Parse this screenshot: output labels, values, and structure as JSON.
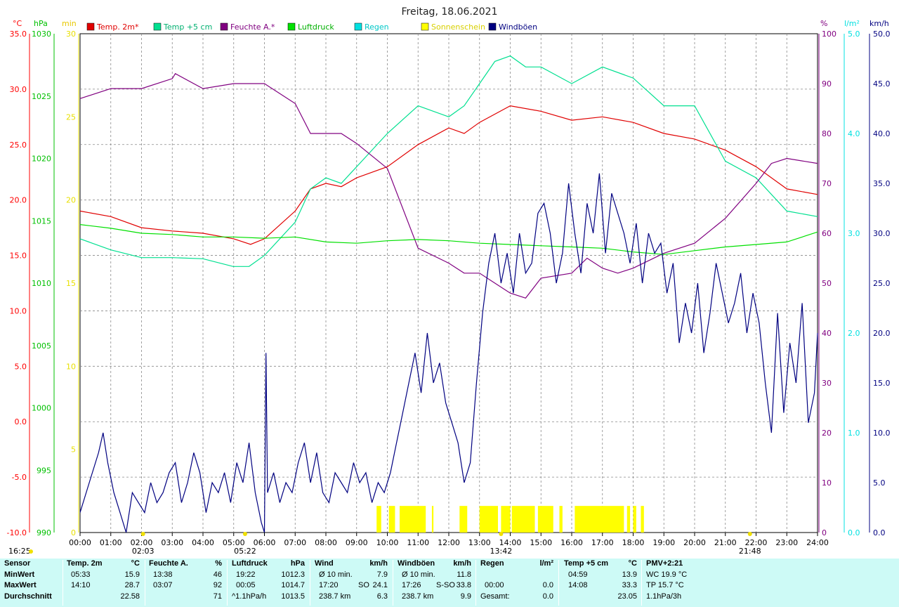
{
  "chart_data": {
    "type": "line",
    "title": "Freitag, 18.06.2021",
    "x_ticks": [
      "00:00",
      "01:00",
      "02:00",
      "03:00",
      "04:00",
      "05:00",
      "06:00",
      "07:00",
      "08:00",
      "09:00",
      "10:00",
      "11:00",
      "12:00",
      "13:00",
      "14:00",
      "15:00",
      "16:00",
      "17:00",
      "18:00",
      "19:00",
      "20:00",
      "21:00",
      "22:00",
      "23:00",
      "24:00"
    ],
    "axes": {
      "temp": {
        "unit": "°C",
        "range": [
          -10,
          35
        ],
        "ticks": [
          "35.0",
          "30.0",
          "25.0",
          "20.0",
          "15.0",
          "10.0",
          "5.0",
          "0.0",
          "-5.0",
          "-10.0"
        ],
        "color": "#ff0000"
      },
      "pressure": {
        "unit": "hPa",
        "range": [
          990,
          1030
        ],
        "ticks": [
          "1030",
          "1025",
          "1020",
          "1015",
          "1010",
          "1005",
          "1000",
          "995",
          "990"
        ],
        "color": "#00c000"
      },
      "sunshine": {
        "unit": "min",
        "range": [
          0,
          30
        ],
        "ticks": [
          "30",
          "25",
          "20",
          "15",
          "10",
          "5",
          "0"
        ],
        "color": "#e0e000"
      },
      "humidity": {
        "unit": "%",
        "range": [
          0,
          100
        ],
        "ticks": [
          "100",
          "90",
          "80",
          "70",
          "60",
          "50",
          "40",
          "30",
          "20",
          "10",
          "0"
        ],
        "color": "#800080"
      },
      "rain": {
        "unit": "l/m²",
        "range": [
          0,
          5
        ],
        "ticks": [
          "5.0",
          "4.0",
          "3.0",
          "2.0",
          "1.0",
          "0.0"
        ],
        "color": "#00e0e0"
      },
      "wind": {
        "unit": "km/h",
        "range": [
          0,
          50
        ],
        "ticks": [
          "50.0",
          "45.0",
          "40.0",
          "35.0",
          "30.0",
          "25.0",
          "20.0",
          "15.0",
          "10.0",
          "5.0",
          "0.0"
        ],
        "color": "#000080"
      }
    },
    "series": [
      {
        "name": "Temp. 2m*",
        "color": "#e00000",
        "axis": "temp",
        "x": [
          0,
          1,
          2,
          3,
          4,
          5,
          5.55,
          6,
          7,
          7.5,
          8,
          8.5,
          9,
          10,
          11,
          12,
          12.5,
          13,
          14,
          15,
          16,
          17,
          18,
          19,
          20,
          21,
          22,
          23,
          24
        ],
        "y": [
          19.0,
          18.5,
          17.5,
          17.2,
          17.0,
          16.5,
          16.0,
          16.5,
          19.0,
          21.0,
          21.5,
          21.2,
          22.0,
          23.0,
          25.0,
          26.5,
          26.0,
          27.0,
          28.5,
          28.0,
          27.2,
          27.5,
          27.0,
          26.0,
          25.5,
          24.5,
          23.0,
          21.0,
          20.5
        ]
      },
      {
        "name": "Temp +5 cm",
        "color": "#00e090",
        "axis": "temp",
        "x": [
          0,
          1,
          2,
          3,
          4,
          4.98,
          5.5,
          6,
          7,
          7.5,
          8,
          8.5,
          9,
          10,
          11,
          11.5,
          12,
          12.5,
          13,
          13.5,
          14,
          14.5,
          15,
          16,
          17,
          18,
          19,
          20,
          21,
          22,
          23,
          24
        ],
        "y": [
          16.5,
          15.5,
          14.8,
          14.8,
          14.7,
          14.0,
          14.0,
          15.0,
          18.0,
          21.0,
          22.0,
          21.5,
          23.0,
          26.0,
          28.5,
          28.0,
          27.5,
          28.5,
          30.5,
          32.5,
          33.0,
          32.0,
          32.0,
          30.5,
          32.0,
          31.0,
          28.5,
          28.5,
          23.5,
          22.0,
          19.0,
          18.5
        ]
      },
      {
        "name": "Feuchte A.*",
        "color": "#800080",
        "axis": "humidity",
        "x": [
          0,
          1,
          2,
          3,
          3.1,
          4,
          5,
          6,
          7,
          7.5,
          8,
          8.5,
          9,
          10,
          11,
          12,
          12.5,
          13,
          13.5,
          14,
          14.5,
          15,
          16,
          16.5,
          17,
          17.5,
          18,
          19,
          20,
          21,
          22,
          22.5,
          23,
          24
        ],
        "y": [
          87,
          89,
          89,
          91,
          92,
          89,
          90,
          90,
          86,
          80,
          80,
          80,
          78,
          73,
          57,
          54,
          52,
          52,
          50,
          48,
          47,
          51,
          52,
          55,
          53,
          52,
          53,
          56,
          58,
          63,
          70,
          74,
          75,
          74
        ]
      },
      {
        "name": "Luftdruck",
        "color": "#00e000",
        "axis": "pressure",
        "x": [
          0,
          1,
          2,
          3,
          4,
          5,
          6,
          7,
          8,
          9,
          10,
          11,
          12,
          13,
          14,
          15,
          16,
          17,
          18,
          19,
          20,
          21,
          22,
          23,
          24
        ],
        "y": [
          1014.7,
          1014.4,
          1014.0,
          1013.9,
          1013.7,
          1013.7,
          1013.6,
          1013.7,
          1013.3,
          1013.2,
          1013.4,
          1013.5,
          1013.4,
          1013.2,
          1013.1,
          1013.0,
          1012.9,
          1012.8,
          1012.5,
          1012.3,
          1012.6,
          1012.9,
          1013.1,
          1013.3,
          1014.1
        ]
      },
      {
        "name": "Regen",
        "color": "#00e0e0",
        "axis": "rain",
        "x": [],
        "y": []
      },
      {
        "name": "Sonnenschein",
        "color": "#ffff00",
        "axis": "sunshine",
        "blocks": [
          [
            9.65,
            9.8
          ],
          [
            10.05,
            10.25
          ],
          [
            10.4,
            11.25
          ],
          [
            11.45,
            11.5
          ],
          [
            12.35,
            12.6
          ],
          [
            13.0,
            13.6
          ],
          [
            13.7,
            14.0
          ],
          [
            14.05,
            14.8
          ],
          [
            14.9,
            15.4
          ],
          [
            15.6,
            15.7
          ],
          [
            16.1,
            17.7
          ],
          [
            17.8,
            17.9
          ],
          [
            18.0,
            18.1
          ],
          [
            18.25,
            18.35
          ]
        ],
        "value": 1
      },
      {
        "name": "Windböen",
        "color": "#000080",
        "axis": "wind",
        "x": [
          0,
          0.3,
          0.6,
          0.75,
          0.9,
          1.1,
          1.3,
          1.5,
          1.7,
          1.9,
          2.1,
          2.3,
          2.5,
          2.7,
          2.9,
          3.1,
          3.3,
          3.5,
          3.7,
          3.9,
          4.1,
          4.3,
          4.5,
          4.7,
          4.9,
          5.1,
          5.3,
          5.5,
          5.7,
          5.9,
          6.0,
          6.05,
          6.1,
          6.3,
          6.5,
          6.7,
          6.9,
          7.1,
          7.3,
          7.5,
          7.7,
          7.9,
          8.1,
          8.3,
          8.5,
          8.7,
          8.9,
          9.1,
          9.3,
          9.5,
          9.7,
          9.9,
          10.1,
          10.3,
          10.5,
          10.7,
          10.9,
          11.1,
          11.3,
          11.5,
          11.7,
          11.9,
          12.1,
          12.3,
          12.5,
          12.7,
          12.9,
          13.1,
          13.3,
          13.5,
          13.7,
          13.9,
          14.1,
          14.3,
          14.5,
          14.7,
          14.9,
          15.1,
          15.3,
          15.5,
          15.7,
          15.9,
          16.1,
          16.3,
          16.5,
          16.7,
          16.9,
          17.1,
          17.3,
          17.5,
          17.7,
          17.9,
          18.1,
          18.3,
          18.5,
          18.7,
          18.9,
          19.1,
          19.3,
          19.5,
          19.7,
          19.9,
          20.1,
          20.3,
          20.5,
          20.7,
          20.9,
          21.1,
          21.3,
          21.5,
          21.7,
          21.9,
          22.1,
          22.3,
          22.5,
          22.7,
          22.9,
          23.1,
          23.3,
          23.5,
          23.7,
          23.9,
          24.0
        ],
        "y": [
          2,
          5,
          8,
          10,
          7,
          4,
          2,
          0,
          4,
          3,
          2,
          5,
          3,
          4,
          6,
          7,
          3,
          5,
          8,
          6,
          2,
          5,
          4,
          6,
          3,
          7,
          5,
          9,
          4,
          1,
          0,
          18,
          4,
          6,
          3,
          5,
          4,
          7,
          9,
          5,
          8,
          4,
          3,
          6,
          5,
          4,
          7,
          5,
          6,
          3,
          5,
          4,
          6,
          9,
          12,
          15,
          18,
          14,
          20,
          15,
          17,
          13,
          11,
          9,
          5,
          7,
          15,
          22,
          27,
          30,
          25,
          28,
          24,
          30,
          26,
          27,
          32,
          33,
          30,
          25,
          28,
          35,
          30,
          26,
          33,
          30,
          36,
          28,
          34,
          32,
          30,
          27,
          31,
          25,
          30,
          28,
          29,
          24,
          27,
          19,
          23,
          20,
          25,
          18,
          22,
          27,
          24,
          21,
          23,
          26,
          20,
          24,
          21,
          15,
          10,
          22,
          12,
          19,
          15,
          23,
          11,
          14,
          20
        ]
      }
    ]
  },
  "legend": [
    {
      "label": "Temp. 2m*",
      "color": "#e00000"
    },
    {
      "label": "Temp +5 cm",
      "color": "#00e090"
    },
    {
      "label": "Feuchte A.*",
      "color": "#800080"
    },
    {
      "label": "Luftdruck",
      "color": "#00e000"
    },
    {
      "label": "Regen",
      "color": "#00e0e0"
    },
    {
      "label": "Sonnenschein",
      "color": "#ffff00"
    },
    {
      "label": "Windböen",
      "color": "#000080"
    }
  ],
  "time_markers": [
    {
      "label": "16:25",
      "time": -0.3
    },
    {
      "label": "02:03",
      "time": 2.05
    },
    {
      "label": "05:22",
      "time": 5.37
    },
    {
      "label": "13:42",
      "time": 13.7
    },
    {
      "label": "21:48",
      "time": 21.8
    }
  ],
  "stats": {
    "sensor": {
      "h1": "Sensor",
      "r1": "MinWert",
      "r2": "MaxWert",
      "r3": "Durchschnitt"
    },
    "temp2m": {
      "h1": "Temp. 2m",
      "u": "°C",
      "min_t": "05:33",
      "min_v": "15.9",
      "max_t": "14:10",
      "max_v": "28.7",
      "avg": "22.58"
    },
    "feuchte": {
      "h1": "Feuchte A.",
      "u": "%",
      "min_t": "13:38",
      "min_v": "46",
      "max_t": "03:07",
      "max_v": "92",
      "avg": "71"
    },
    "luftdruck": {
      "h1": "Luftdruck",
      "u": "hPa",
      "min_t": "19:22",
      "min_v": "1012.3",
      "max_t": "00:05",
      "max_v": "1014.7",
      "avg_l": "^1.1hPa/h",
      "avg": "1013.5"
    },
    "wind": {
      "h1": "Wind",
      "u": "km/h",
      "min_t": "Ø 10 min.",
      "min_v": "7.9",
      "max_t": "17:20",
      "max_d": "SO",
      "max_v": "24.1",
      "avg_l": "238.7 km",
      "avg": "6.3"
    },
    "boeen": {
      "h1": "Windböen",
      "u": "km/h",
      "min_t": "Ø 10 min.",
      "min_v": "11.8",
      "max_t": "17:26",
      "max_d": "S-SO",
      "max_v": "33.8",
      "avg_l": "238.7 km",
      "avg": "9.9"
    },
    "regen": {
      "h1": "Regen",
      "u": "l/m²",
      "max_t": "00:00",
      "max_v": "0.0",
      "avg_l": "Gesamt:",
      "avg": "0.0"
    },
    "temp5": {
      "h1": "Temp +5 cm",
      "u": "°C",
      "min_t": "04:59",
      "min_v": "13.9",
      "max_t": "14:08",
      "max_v": "33.3",
      "avg": "23.05"
    },
    "pmv": {
      "h1": "PMV+2:21",
      "r1": "WC 19.9 °C",
      "r2": "TP 15.7 °C",
      "r3": "1.1hPa/3h"
    }
  }
}
